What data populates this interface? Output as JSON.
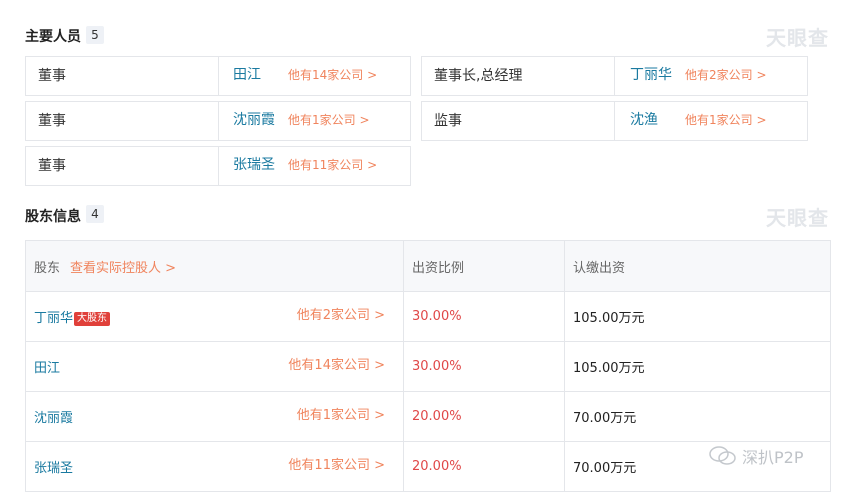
{
  "section1": {
    "title": "主要人员",
    "count": "5",
    "watermark": "天眼查",
    "cards": [
      {
        "role": "董事",
        "person": "田江",
        "more": "他有14家公司 >"
      },
      {
        "role": "董事长,总经理",
        "person": "丁丽华",
        "more": "他有2家公司 >"
      },
      {
        "role": "董事",
        "person": "沈丽霞",
        "more": "他有1家公司 >"
      },
      {
        "role": "监事",
        "person": "沈渔",
        "more": "他有1家公司 >"
      },
      {
        "role": "董事",
        "person": "张瑞圣",
        "more": "他有11家公司 >"
      }
    ]
  },
  "section2": {
    "title": "股东信息",
    "count": "4",
    "watermark": "天眼查",
    "header": {
      "shareholder": "股东",
      "controller_link": "查看实际控股人 >",
      "ratio": "出资比例",
      "amount": "认缴出资"
    },
    "rows": [
      {
        "name": "丁丽华",
        "badge": "大股东",
        "more": "他有2家公司 >",
        "ratio": "30.00%",
        "amount": "105.00万元"
      },
      {
        "name": "田江",
        "more": "他有14家公司 >",
        "ratio": "30.00%",
        "amount": "105.00万元"
      },
      {
        "name": "沈丽霞",
        "more": "他有1家公司 >",
        "ratio": "20.00%",
        "amount": "70.00万元"
      },
      {
        "name": "张瑞圣",
        "more": "他有11家公司 >",
        "ratio": "20.00%",
        "amount": "70.00万元"
      }
    ]
  },
  "wechat_watermark": "深扒P2P",
  "colors": {
    "link": "#1a7aa0",
    "more": "#f0845d",
    "ratio": "#e04848",
    "badge": "#e0403a"
  }
}
